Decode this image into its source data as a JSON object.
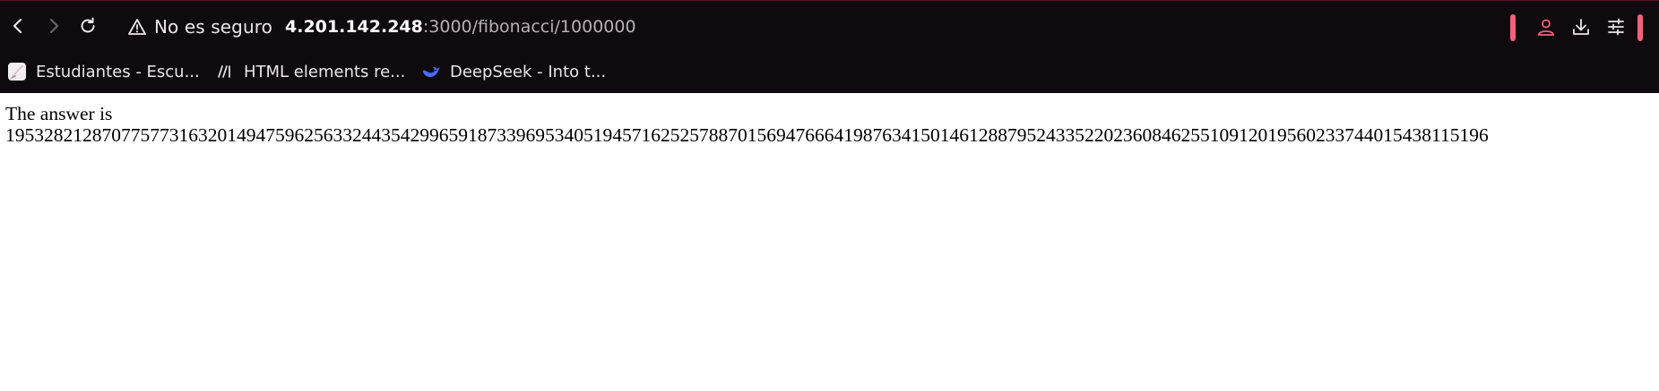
{
  "browser": {
    "nav": {
      "back_icon": "chevron-left-icon",
      "forward_icon": "chevron-right-icon",
      "reload_icon": "reload-icon"
    },
    "security": {
      "icon": "warning-triangle-icon",
      "label": "No es seguro"
    },
    "url": {
      "host": "4.201.142.248",
      "path": ":3000/fibonacci/1000000"
    },
    "accent_color": "#f2617c",
    "tools": [
      "profile-icon",
      "download-icon",
      "settings-sliders-icon"
    ]
  },
  "bookmarks": [
    {
      "label": "Estudiantes - Escu...",
      "icon": "notebook-icon"
    },
    {
      "label": "HTML elements re...",
      "icon": "mdn-logo-icon"
    },
    {
      "label": "DeepSeek - Into t...",
      "icon": "deepseek-whale-icon"
    }
  ],
  "page": {
    "answer_label": "The answer is",
    "answer_value": "1953282128707757731632014947596256332443542996591873396953405194571625257887015694766641987634150146128879524335220236084625510912019560233744015438115196"
  },
  "colors": {
    "chrome_bg": "#0e0a0d",
    "chrome_text": "#ece6ea",
    "url_path": "#b9b0b6",
    "deepseek_blue": "#4d6bfe"
  }
}
